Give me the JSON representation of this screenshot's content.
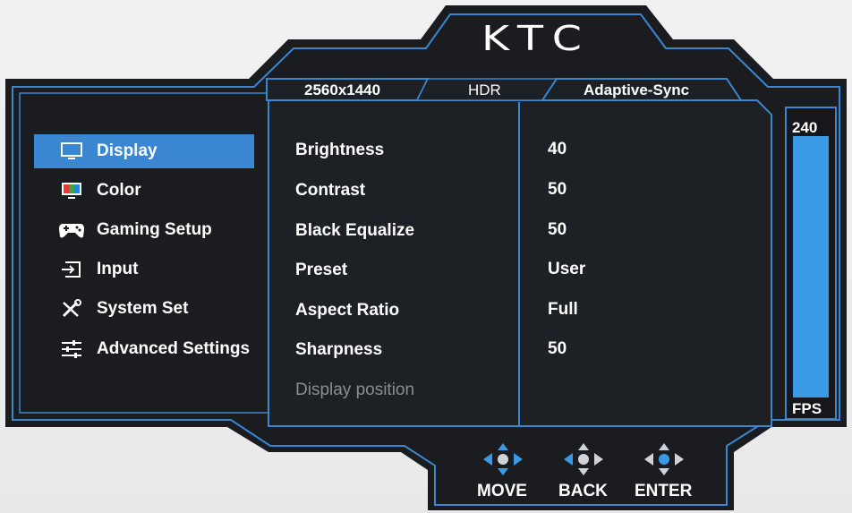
{
  "brand": "KTC",
  "tabs": [
    {
      "label": "2560x1440",
      "enabled": true
    },
    {
      "label": "HDR",
      "enabled": false
    },
    {
      "label": "Adaptive-Sync",
      "enabled": true
    }
  ],
  "menu": {
    "selected": "Display",
    "items": [
      {
        "label": "Display",
        "icon": "monitor-icon"
      },
      {
        "label": "Color",
        "icon": "color-icon"
      },
      {
        "label": "Gaming Setup",
        "icon": "gamepad-icon"
      },
      {
        "label": "Input",
        "icon": "input-icon"
      },
      {
        "label": "System Set",
        "icon": "tools-icon"
      },
      {
        "label": "Advanced Settings",
        "icon": "sliders-icon"
      }
    ]
  },
  "settings": [
    {
      "label": "Brightness",
      "value": "40"
    },
    {
      "label": "Contrast",
      "value": "50"
    },
    {
      "label": "Black Equalize",
      "value": "50"
    },
    {
      "label": "Preset",
      "value": "User"
    },
    {
      "label": "Aspect Ratio",
      "value": "Full"
    },
    {
      "label": "Sharpness",
      "value": "50"
    },
    {
      "label": "Display position",
      "value": "",
      "enabled": false
    }
  ],
  "fps": {
    "value": "240",
    "unit": "FPS",
    "level": 1.0
  },
  "nav": [
    {
      "label": "MOVE",
      "icon": "dpad-icon"
    },
    {
      "label": "BACK",
      "icon": "dpad-icon"
    },
    {
      "label": "ENTER",
      "icon": "dpad-icon"
    }
  ],
  "colors": {
    "accent": "#3a86d0",
    "panel": "#1d2025",
    "frame": "#1a1c20",
    "background": "#efefef"
  }
}
